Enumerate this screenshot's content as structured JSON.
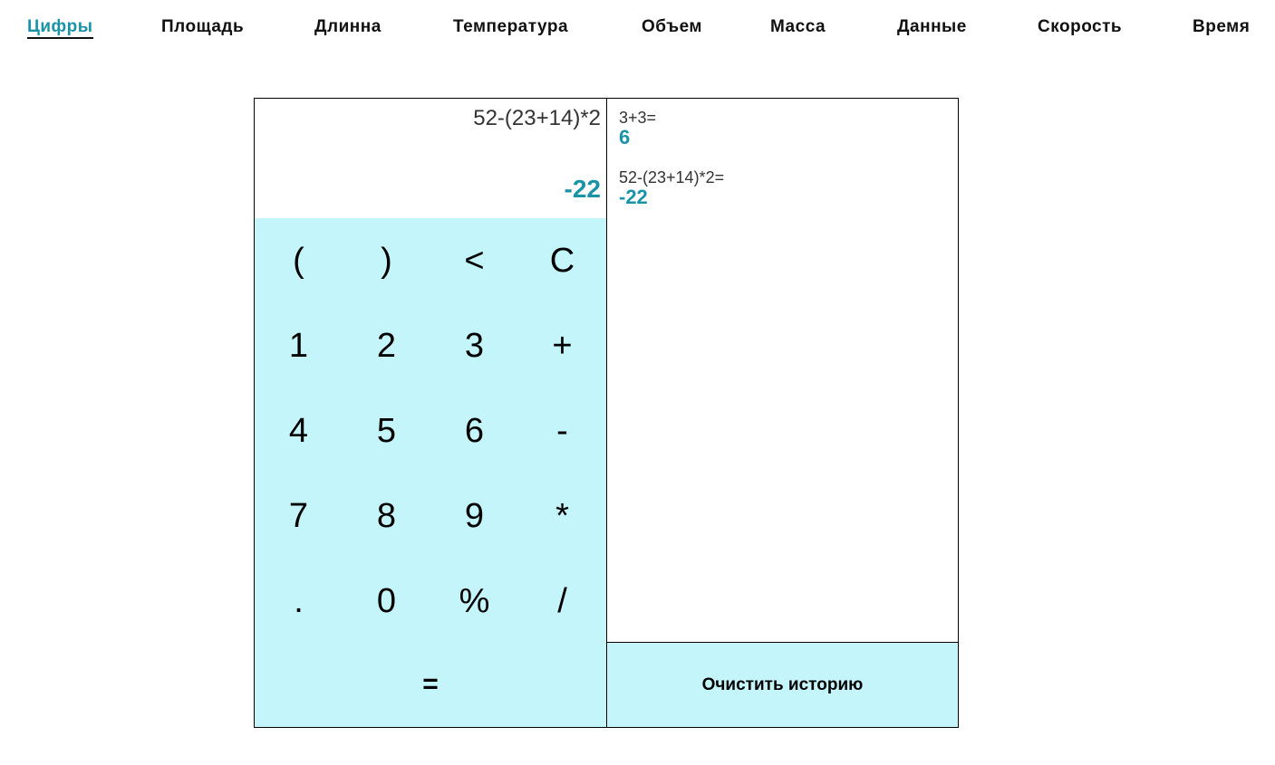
{
  "nav": {
    "items": [
      {
        "label": "Цифры",
        "active": true
      },
      {
        "label": "Площадь",
        "active": false
      },
      {
        "label": "Длинна",
        "active": false
      },
      {
        "label": "Температура",
        "active": false
      },
      {
        "label": "Объем",
        "active": false
      },
      {
        "label": "Масса",
        "active": false
      },
      {
        "label": "Данные",
        "active": false
      },
      {
        "label": "Скорость",
        "active": false
      },
      {
        "label": "Время",
        "active": false
      }
    ]
  },
  "display": {
    "expression": "52-(23+14)*2",
    "result": "-22"
  },
  "keypad": {
    "keys": [
      "(",
      ")",
      "<",
      "C",
      "1",
      "2",
      "3",
      "+",
      "4",
      "5",
      "6",
      "-",
      "7",
      "8",
      "9",
      "*",
      ".",
      "0",
      "%",
      "/"
    ],
    "equals": "="
  },
  "history": {
    "entries": [
      {
        "expression": "3+3=",
        "result": "6"
      },
      {
        "expression": "52-(23+14)*2=",
        "result": "-22"
      }
    ],
    "clear_label": "Очистить историю"
  },
  "colors": {
    "accent": "#1a93a8",
    "keypad_bg": "#c4f5fb"
  }
}
